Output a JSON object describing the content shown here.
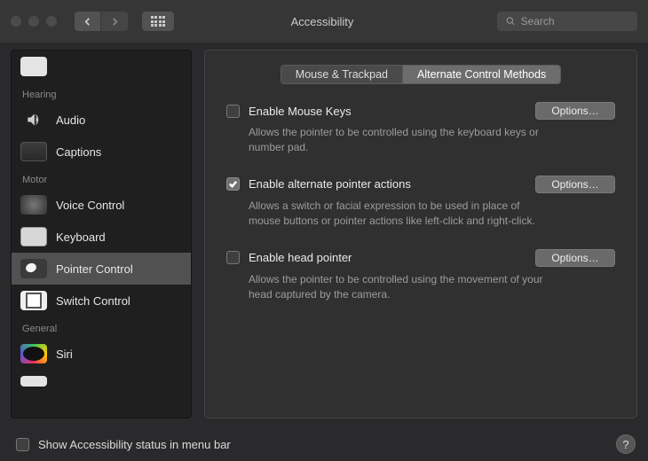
{
  "window": {
    "title": "Accessibility",
    "search_placeholder": "Search"
  },
  "sidebar": {
    "sections": [
      {
        "label": "Hearing",
        "items": [
          {
            "id": "audio",
            "label": "Audio"
          },
          {
            "id": "captions",
            "label": "Captions"
          }
        ]
      },
      {
        "label": "Motor",
        "items": [
          {
            "id": "voice-control",
            "label": "Voice Control"
          },
          {
            "id": "keyboard",
            "label": "Keyboard"
          },
          {
            "id": "pointer-control",
            "label": "Pointer Control",
            "selected": true
          },
          {
            "id": "switch-control",
            "label": "Switch Control"
          }
        ]
      },
      {
        "label": "General",
        "items": [
          {
            "id": "siri",
            "label": "Siri"
          }
        ]
      }
    ]
  },
  "tabs": [
    {
      "id": "mouse-trackpad",
      "label": "Mouse & Trackpad",
      "active": false
    },
    {
      "id": "alt-control",
      "label": "Alternate Control Methods",
      "active": true
    }
  ],
  "options": [
    {
      "id": "mouse-keys",
      "label": "Enable Mouse Keys",
      "checked": false,
      "button": "Options…",
      "desc": "Allows the pointer to be controlled using the keyboard keys or number pad."
    },
    {
      "id": "alt-pointer",
      "label": "Enable alternate pointer actions",
      "checked": true,
      "button": "Options…",
      "desc": "Allows a switch or facial expression to be used in place of mouse buttons or pointer actions like left-click and right-click."
    },
    {
      "id": "head-pointer",
      "label": "Enable head pointer",
      "checked": false,
      "button": "Options…",
      "desc": "Allows the pointer to be controlled using the movement of your head captured by the camera."
    }
  ],
  "footer": {
    "checkbox_label": "Show Accessibility status in menu bar",
    "checked": false,
    "help": "?"
  }
}
